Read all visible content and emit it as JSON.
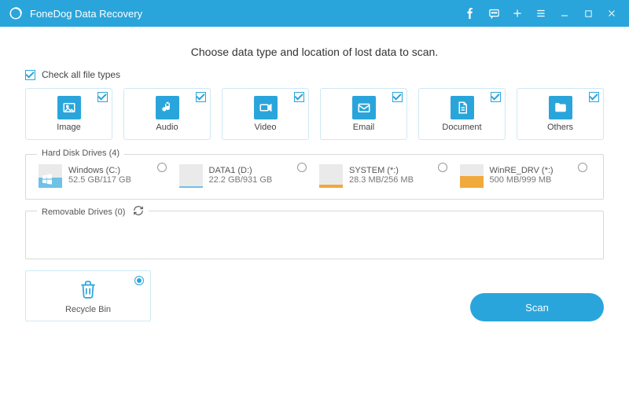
{
  "app": {
    "title": "FoneDog Data Recovery"
  },
  "heading": "Choose data type and location of lost data to scan.",
  "checkall_label": "Check all file types",
  "filetypes": [
    {
      "label": "Image",
      "icon": "image-icon",
      "checked": true
    },
    {
      "label": "Audio",
      "icon": "audio-icon",
      "checked": true
    },
    {
      "label": "Video",
      "icon": "video-icon",
      "checked": true
    },
    {
      "label": "Email",
      "icon": "email-icon",
      "checked": true
    },
    {
      "label": "Document",
      "icon": "document-icon",
      "checked": true
    },
    {
      "label": "Others",
      "icon": "folder-icon",
      "checked": true
    }
  ],
  "hdd": {
    "legend": "Hard Disk Drives (4)",
    "drives": [
      {
        "name": "Windows (C:)",
        "size": "52.5 GB/117 GB",
        "fill": 45,
        "tone": "blue",
        "overlay": "win"
      },
      {
        "name": "DATA1 (D:)",
        "size": "22.2 GB/931 GB",
        "fill": 8,
        "tone": "blue",
        "overlay": ""
      },
      {
        "name": "SYSTEM (*:)",
        "size": "28.3 MB/256 MB",
        "fill": 12,
        "tone": "orange",
        "overlay": ""
      },
      {
        "name": "WinRE_DRV (*:)",
        "size": "500 MB/999 MB",
        "fill": 50,
        "tone": "orange",
        "overlay": ""
      }
    ]
  },
  "removable": {
    "legend": "Removable Drives (0)"
  },
  "recycle": {
    "label": "Recycle Bin",
    "selected": true
  },
  "scan_label": "Scan"
}
